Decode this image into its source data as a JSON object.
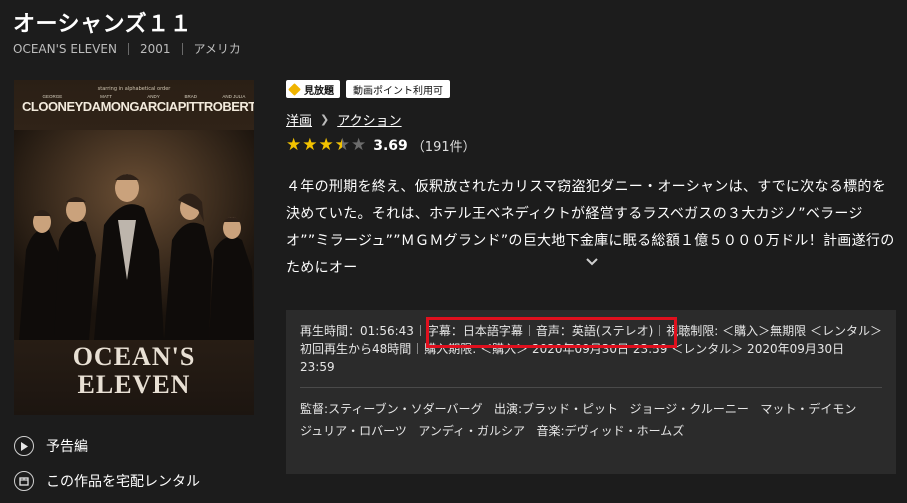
{
  "title": "オーシャンズ１１",
  "meta": {
    "original_title": "OCEAN'S ELEVEN",
    "year": "2001",
    "country": "アメリカ"
  },
  "poster": {
    "tagline": "starring in alphabetical order",
    "cast": [
      {
        "first": "GEORGE",
        "last": "CLOONEY"
      },
      {
        "first": "MATT",
        "last": "DAMON"
      },
      {
        "first": "ANDY",
        "last": "GARCIA"
      },
      {
        "first": "BRAD",
        "last": "PITT"
      },
      {
        "first": "AND JULIA",
        "last": "ROBERTS"
      }
    ],
    "title_line1": "OCEAN'S",
    "title_line2": "ELEVEN"
  },
  "actions": {
    "trailer": "予告編",
    "rental": "この作品を宅配レンタル"
  },
  "badges": {
    "mihoudai": "見放題",
    "point": "動画ポイント利用可"
  },
  "genres": [
    "洋画",
    "アクション"
  ],
  "rating": {
    "score": "3.69",
    "count": "（191件）",
    "stars": 3.5
  },
  "synopsis": "４年の刑期を終え、仮釈放されたカリスマ窃盗犯ダニー・オーシャンは、すでに次なる標的を決めていた。それは、ホテル王ベネディクトが経営するラスベガスの３大カジノ”ベラージオ””ミラージュ””ＭＧＭグランド”の巨大地下金庫に眠る総額１億５０００万ドル！計画遂行のためにオー",
  "info": {
    "runtime": "再生時間：01:56:43",
    "subtitle": "字幕：日本語字幕",
    "audio": "音声：英語(ステレオ)",
    "restriction": "視聴制限: ＜購入＞無期限 ＜レンタル＞初回再生から48時間",
    "purchase_deadline": "購入期限: ＜購入＞ 2020年09月30日 23:59 ＜レンタル＞ 2020年09月30日 23:59"
  },
  "credits": {
    "director_label": "監督",
    "director": "スティーブン・ソダーバーグ",
    "cast_label": "出演",
    "cast": [
      "ブラッド・ピット",
      "ジョージ・クルーニー",
      "マット・デイモン",
      "ジュリア・ロバーツ",
      "アンディ・ガルシア"
    ],
    "music_label": "音楽",
    "music": "デヴィッド・ホームズ"
  },
  "colors": {
    "background": "#1c1c1c",
    "panel": "#2b2b2b",
    "star": "#f2c200",
    "highlight_box": "#e0101e",
    "mihoudai_icon": "#f0b400"
  }
}
